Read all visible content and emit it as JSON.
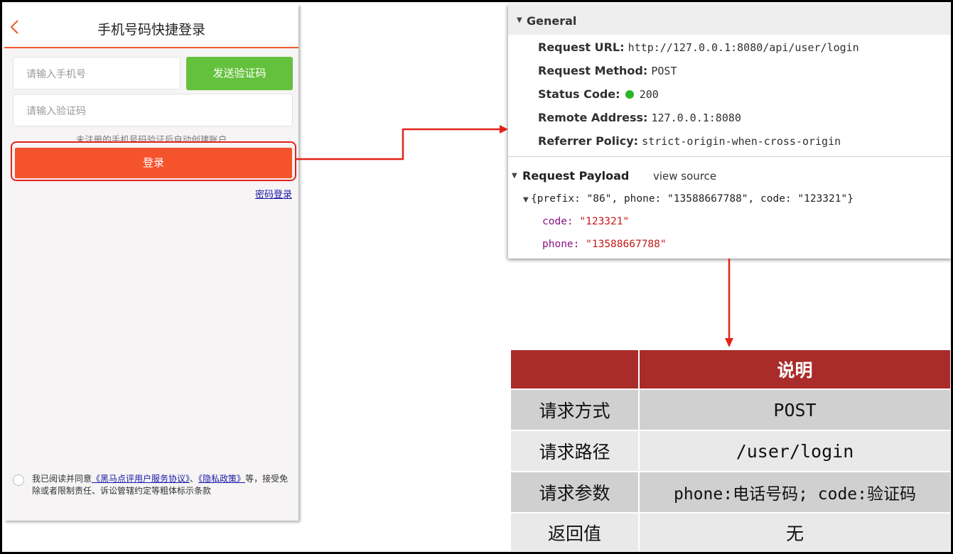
{
  "phone_login": {
    "title": "手机号码快捷登录",
    "phone_placeholder": "请输入手机号",
    "send_code_label": "发送验证码",
    "code_placeholder": "请输入验证码",
    "hint": "未注册的手机号码验证后自动创建账户",
    "login_label": "登录",
    "password_login_label": "密码登录",
    "agreement": {
      "prefix": "我已阅读并同意",
      "link1": "《黑马点评用户服务协议》",
      "sep": "、",
      "link2": "《隐私政策》",
      "suffix": "等，接受免除或者限制责任、诉讼管辖约定等粗体标示条款"
    }
  },
  "devtools": {
    "general_label": "General",
    "rows": [
      {
        "key": "Request URL:",
        "value": "http://127.0.0.1:8080/api/user/login"
      },
      {
        "key": "Request Method:",
        "value": "POST"
      },
      {
        "key": "Status Code:",
        "value": "200"
      },
      {
        "key": "Remote Address:",
        "value": "127.0.0.1:8080"
      },
      {
        "key": "Referrer Policy:",
        "value": "strict-origin-when-cross-origin"
      }
    ],
    "payload_label": "Request Payload",
    "view_source_label": "view source",
    "payload_summary": "{prefix: \"86\", phone: \"13588667788\", code: \"123321\"}",
    "properties": [
      {
        "key": "code:",
        "value": "\"123321\""
      },
      {
        "key": "phone:",
        "value": "\"13588667788\""
      }
    ]
  },
  "table": {
    "header": [
      "",
      "说明"
    ],
    "rows": [
      [
        "请求方式",
        "POST"
      ],
      [
        "请求路径",
        "/user/login"
      ],
      [
        "请求参数",
        "phone:电话号码; code:验证码"
      ],
      [
        "返回值",
        "无"
      ]
    ]
  },
  "colors": {
    "accent_orange": "#f4532c",
    "send_code_green": "#64c13c",
    "annotation_red": "#e2231a",
    "table_header": "#a92c2a",
    "status_ok": "#2bb52b"
  },
  "icons": [
    "chevron-left-icon",
    "disclosure-triangle-icon",
    "status-dot-icon",
    "arrow-icon"
  ]
}
